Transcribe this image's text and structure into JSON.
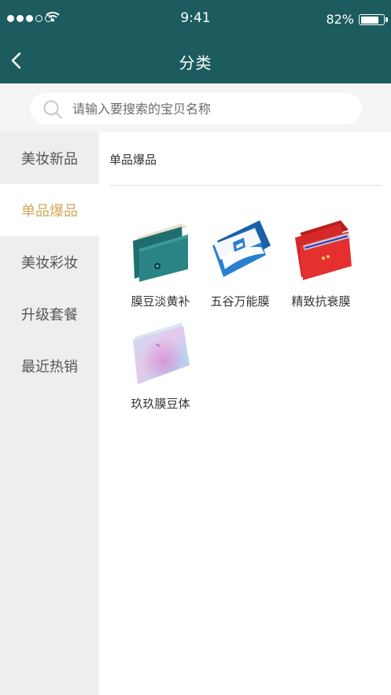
{
  "status_bar": {
    "time": "9:41",
    "battery": "82%"
  },
  "header": {
    "title": "分类"
  },
  "search": {
    "placeholder": "请输入要搜索的宝贝名称"
  },
  "sidebar": {
    "items": [
      {
        "label": "美妆新品"
      },
      {
        "label": "单品爆品"
      },
      {
        "label": "美妆彩妆"
      },
      {
        "label": "升级套餐"
      },
      {
        "label": "最近热销"
      }
    ],
    "active_index": 1
  },
  "main": {
    "section_title": "单品爆品",
    "products": [
      {
        "name": "膜豆淡黄补"
      },
      {
        "name": "五谷万能膜"
      },
      {
        "name": "精致抗衰膜"
      },
      {
        "name": "玖玖膜豆体"
      }
    ]
  },
  "colors": {
    "header_bg": "#1d5c5e",
    "active_text": "#d3a85c",
    "sidebar_bg": "#eeeeee"
  }
}
